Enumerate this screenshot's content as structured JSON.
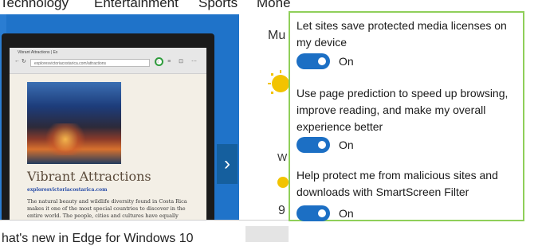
{
  "topnav": {
    "items": [
      "Technology",
      "Entertainment",
      "Sports",
      "Mone"
    ]
  },
  "hero": {
    "browser": {
      "tab_title": "Vibrant Attractions | Ex",
      "url": "exploresvictoriacostarica.com/attractions",
      "toolbar_icons": "☆ ≡ ⊡ ⋯"
    },
    "article": {
      "title": "Vibrant Attractions",
      "link": "exploresvictoriacostarica.com",
      "body": "The natural beauty and wildlife diversity found in Costa Rica makes it one of the most special countries to discover in the entire world. The people, cities and cultures have equally remarkable experience to share. There are a few neighbouring towns a short shuttle trip away that feature"
    },
    "next_arrow": "›"
  },
  "weather": {
    "top_label": "Mu",
    "mid_label": "W",
    "temp_fragment": "9"
  },
  "bottom": {
    "text": "hat's new in Edge for Windows 10"
  },
  "settings": {
    "items": [
      {
        "label": "Let sites save protected media licenses on my device",
        "toggle_state": "On"
      },
      {
        "label": "Use page prediction to speed up browsing, improve reading, and make my overall experience better",
        "toggle_state": "On"
      },
      {
        "label": "Help protect me from malicious sites and downloads with SmartScreen Filter",
        "toggle_state": "On"
      }
    ],
    "colors": {
      "border": "#8fcf5a",
      "toggle_on": "#1c6fc4"
    }
  }
}
